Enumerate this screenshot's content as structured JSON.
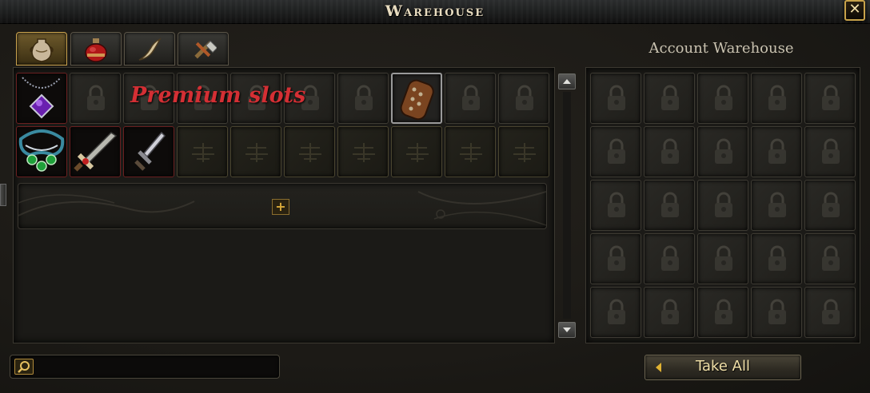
{
  "window": {
    "title": "Warehouse",
    "close_label": "✕"
  },
  "tabs": [
    {
      "name": "tab-equipment",
      "icon": "vase-icon",
      "active": true
    },
    {
      "name": "tab-consumables",
      "icon": "potion-icon",
      "active": false
    },
    {
      "name": "tab-materials",
      "icon": "horn-icon",
      "active": false
    },
    {
      "name": "tab-tools",
      "icon": "tools-icon",
      "active": false
    }
  ],
  "character_warehouse": {
    "premium_label": "Premium slots",
    "expand_label": "+",
    "items": [
      {
        "icon": "amethyst-necklace-icon",
        "row": 1,
        "col": 1
      },
      {
        "icon": "leather-gauntlet-icon",
        "row": 1,
        "col": 8
      },
      {
        "icon": "emerald-necklace-icon",
        "row": 2,
        "col": 1
      },
      {
        "icon": "greatsword-icon",
        "row": 2,
        "col": 2
      },
      {
        "icon": "dagger-icon",
        "row": 2,
        "col": 3
      }
    ]
  },
  "account_warehouse": {
    "title": "Account Warehouse",
    "rows": 5,
    "cols": 5
  },
  "search": {
    "placeholder": "",
    "value": ""
  },
  "take_all": {
    "label": "Take All"
  },
  "colors": {
    "premium_text": "#d42f34",
    "gold_accent": "#c9a24e",
    "button_text": "#f1e0a8"
  }
}
